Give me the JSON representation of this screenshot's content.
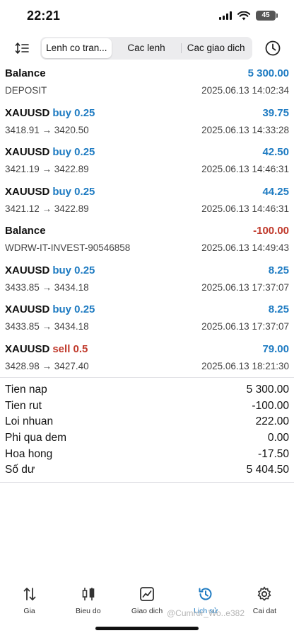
{
  "status_bar": {
    "time": "22:21",
    "battery": "45"
  },
  "tabs": [
    {
      "label": "Lenh co tran...",
      "active": true
    },
    {
      "label": "Cac lenh",
      "active": false
    },
    {
      "label": "Cac giao dich",
      "active": false
    }
  ],
  "history": [
    {
      "symbol": "Balance",
      "side": "",
      "amount": "5 300.00",
      "sub_left": "DEPOSIT",
      "date": "2025.06.13 14:02:34",
      "amount_sign": "pos"
    },
    {
      "symbol": "XAUUSD",
      "side": "buy 0.25",
      "amount": "39.75",
      "sub_left": "3418.91 → 3420.50",
      "date": "2025.06.13 14:33:28",
      "amount_sign": "pos"
    },
    {
      "symbol": "XAUUSD",
      "side": "buy 0.25",
      "amount": "42.50",
      "sub_left": "3421.19 → 3422.89",
      "date": "2025.06.13 14:46:31",
      "amount_sign": "pos"
    },
    {
      "symbol": "XAUUSD",
      "side": "buy 0.25",
      "amount": "44.25",
      "sub_left": "3421.12 → 3422.89",
      "date": "2025.06.13 14:46:31",
      "amount_sign": "pos"
    },
    {
      "symbol": "Balance",
      "side": "",
      "amount": "-100.00",
      "sub_left": "WDRW-IT-INVEST-90546858",
      "date": "2025.06.13 14:49:43",
      "amount_sign": "neg"
    },
    {
      "symbol": "XAUUSD",
      "side": "buy 0.25",
      "amount": "8.25",
      "sub_left": "3433.85 → 3434.18",
      "date": "2025.06.13 17:37:07",
      "amount_sign": "pos"
    },
    {
      "symbol": "XAUUSD",
      "side": "buy 0.25",
      "amount": "8.25",
      "sub_left": "3433.85 → 3434.18",
      "date": "2025.06.13 17:37:07",
      "amount_sign": "pos"
    },
    {
      "symbol": "XAUUSD",
      "side": "sell 0.5",
      "amount": "79.00",
      "sub_left": "3428.98 → 3427.40",
      "date": "2025.06.13 18:21:30",
      "amount_sign": "pos"
    }
  ],
  "summary": [
    {
      "label": "Tien nap",
      "value": "5 300.00"
    },
    {
      "label": "Tien rut",
      "value": "-100.00"
    },
    {
      "label": "Loi nhuan",
      "value": "222.00"
    },
    {
      "label": "Phi qua dem",
      "value": "0.00"
    },
    {
      "label": "Hoa hong",
      "value": "-17.50"
    },
    {
      "label": "Số dư",
      "value": "5 404.50"
    }
  ],
  "nav": [
    {
      "label": "Gia",
      "icon": "arrows-updown-icon",
      "active": false
    },
    {
      "label": "Bieu do",
      "icon": "candlestick-icon",
      "active": false
    },
    {
      "label": "Giao dich",
      "icon": "trade-chart-icon",
      "active": false
    },
    {
      "label": "Lịch sử",
      "icon": "history-icon",
      "active": true
    },
    {
      "label": "Cai dat",
      "icon": "gear-icon",
      "active": false
    }
  ],
  "watermark": "@Cumror_Wo..e382",
  "colors": {
    "accent": "#1e7bc2",
    "negative": "#c0392b"
  }
}
